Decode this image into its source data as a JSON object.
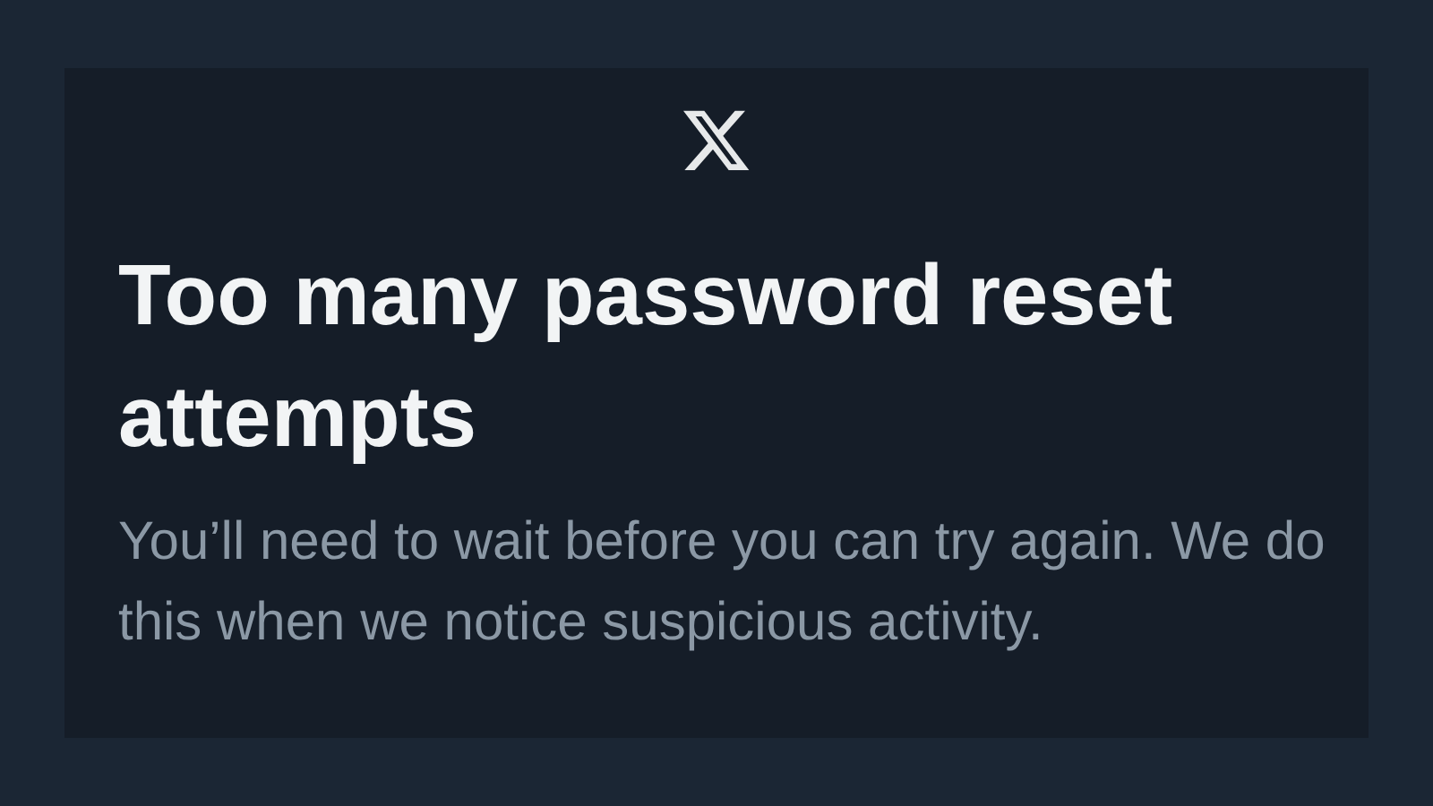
{
  "dialog": {
    "title": "Too many password reset attempts",
    "message": "You’ll need to wait before you can try again. We do this when we notice suspicious activity."
  }
}
